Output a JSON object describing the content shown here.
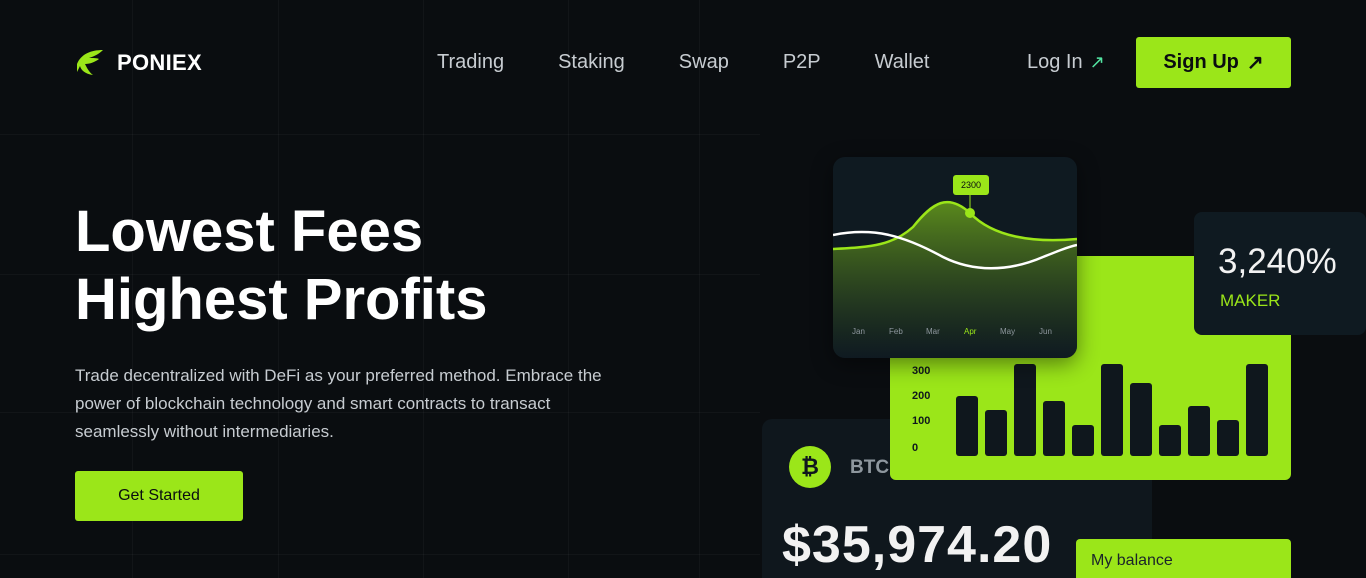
{
  "brand": {
    "name": "PONIEX",
    "accent": "#9be619",
    "background": "#0a0d10"
  },
  "nav": {
    "items": [
      "Trading",
      "Staking",
      "Swap",
      "P2P",
      "Wallet"
    ]
  },
  "header": {
    "login_label": "Log In",
    "signup_label": "Sign Up",
    "arrow_icon": "arrow-up-right-icon"
  },
  "hero": {
    "title_line1": "Lowest Fees",
    "title_line2": "Highest Profits",
    "subtitle": "Trade decentralized with DeFi as your preferred method. Embrace the power of blockchain technology and smart contracts to transact seamlessly without intermediaries.",
    "cta_label": "Get Started"
  },
  "line_chart": {
    "months": [
      "Jan",
      "Feb",
      "Mar",
      "Apr",
      "May",
      "Jun"
    ],
    "highlight_month": "Apr",
    "tooltip_value": "2300"
  },
  "bar_chart": {
    "y_ticks": [
      "300",
      "200",
      "100",
      "0"
    ],
    "values": [
      240,
      185,
      370,
      220,
      125,
      370,
      295,
      125,
      200,
      145,
      370
    ]
  },
  "maker": {
    "value": "3,240%",
    "label": "MAKER"
  },
  "btc": {
    "symbol_icon": "bitcoin-icon",
    "label": "BTC",
    "price": "$35,974.20"
  },
  "balance": {
    "label": "My balance"
  }
}
